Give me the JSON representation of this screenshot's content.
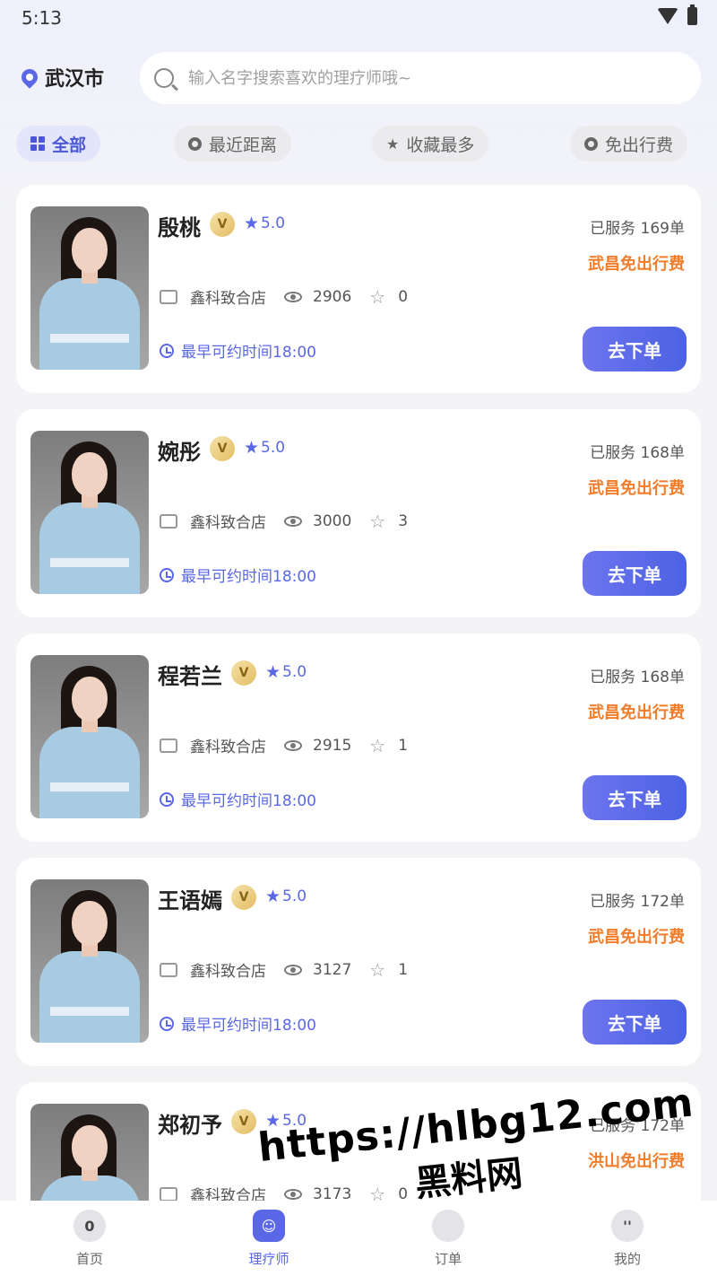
{
  "status_bar": {
    "time": "5:13"
  },
  "header": {
    "city": "武汉市",
    "search_placeholder": "输入名字搜索喜欢的理疗师哦~"
  },
  "filters": [
    {
      "label": "全部",
      "active": true
    },
    {
      "label": "最近距离",
      "active": false
    },
    {
      "label": "收藏最多",
      "active": false
    },
    {
      "label": "免出行费",
      "active": false
    }
  ],
  "therapist_list": {
    "store_label": "鑫科致合店",
    "earliest_label": "最早可约时间18:00",
    "order_button": "去下单",
    "vip_badge": "V",
    "items": [
      {
        "name": "殷桃",
        "rating": "5.0",
        "served": "已服务 169单",
        "free_fee": "武昌免出行费",
        "views": "2906",
        "favorites": "0"
      },
      {
        "name": "婉彤",
        "rating": "5.0",
        "served": "已服务 168单",
        "free_fee": "武昌免出行费",
        "views": "3000",
        "favorites": "3"
      },
      {
        "name": "程若兰",
        "rating": "5.0",
        "served": "已服务 168单",
        "free_fee": "武昌免出行费",
        "views": "2915",
        "favorites": "1"
      },
      {
        "name": "王语嫣",
        "rating": "5.0",
        "served": "已服务 172单",
        "free_fee": "武昌免出行费",
        "views": "3127",
        "favorites": "1"
      },
      {
        "name": "郑初予",
        "rating": "5.0",
        "served": "已服务 172单",
        "free_fee": "洪山免出行费",
        "views": "3173",
        "favorites": "0"
      }
    ]
  },
  "bottom_nav": [
    {
      "label": "首页",
      "icon": "home-icon",
      "glyph": "0"
    },
    {
      "label": "理疗师",
      "icon": "therapist-icon",
      "glyph": "",
      "active": true
    },
    {
      "label": "订单",
      "icon": "order-icon",
      "glyph": ""
    },
    {
      "label": "我的",
      "icon": "profile-icon",
      "glyph": "''"
    }
  ],
  "watermark": {
    "url": "https://hlbg12.com",
    "site": "黑料网"
  },
  "colors": {
    "accent": "#5a67e6",
    "free_fee": "#ef7d2b",
    "badge_gold": "#e3bd63"
  }
}
